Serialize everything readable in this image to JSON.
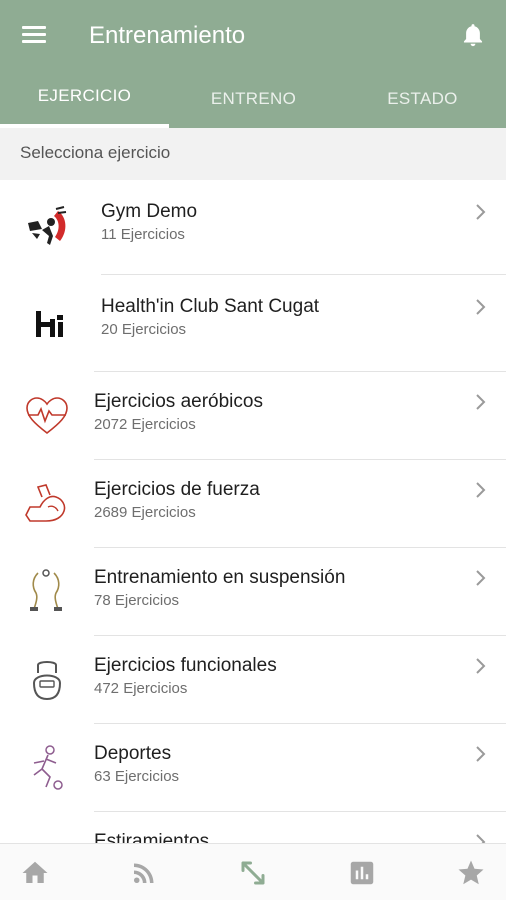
{
  "appbar": {
    "title": "Entrenamiento",
    "menu_icon": "hamburger-menu-icon",
    "notification_icon": "bell-icon",
    "color": "#8fac93"
  },
  "tabs": [
    {
      "label": "EJERCICIO",
      "active": true
    },
    {
      "label": "ENTRENO",
      "active": false
    },
    {
      "label": "ESTADO",
      "active": false
    }
  ],
  "subheader": "Selecciona ejercicio",
  "rows": [
    {
      "name": "Gym Demo",
      "count": "11 Ejercicios",
      "icon": "gym-demo-logo-icon"
    },
    {
      "name": "Health'in Club Sant Cugat",
      "count": "20 Ejercicios",
      "icon": "healthin-logo-icon"
    },
    {
      "name": "Ejercicios aeróbicos",
      "count": "2072 Ejercicios",
      "icon": "heart-pulse-icon"
    },
    {
      "name": "Ejercicios de fuerza",
      "count": "2689 Ejercicios",
      "icon": "flexed-arm-icon"
    },
    {
      "name": "Entrenamiento en suspensión",
      "count": "78 Ejercicios",
      "icon": "suspension-straps-icon"
    },
    {
      "name": "Ejercicios funcionales",
      "count": "472 Ejercicios",
      "icon": "kettlebell-icon"
    },
    {
      "name": "Deportes",
      "count": "63 Ejercicios",
      "icon": "soccer-player-icon"
    },
    {
      "name": "Estiramientos",
      "count": "",
      "icon": "stretching-icon"
    }
  ],
  "bottom_nav": [
    {
      "icon": "home-icon",
      "active": false
    },
    {
      "icon": "feed-icon",
      "active": false
    },
    {
      "icon": "expand-arrows-icon",
      "active": true
    },
    {
      "icon": "bar-chart-icon",
      "active": false
    },
    {
      "icon": "star-icon",
      "active": false
    }
  ],
  "colors": {
    "accent": "#8fac93",
    "icon_red": "#c0392b",
    "icon_purple": "#8e5d8f",
    "icon_olive": "#a08a4a"
  }
}
